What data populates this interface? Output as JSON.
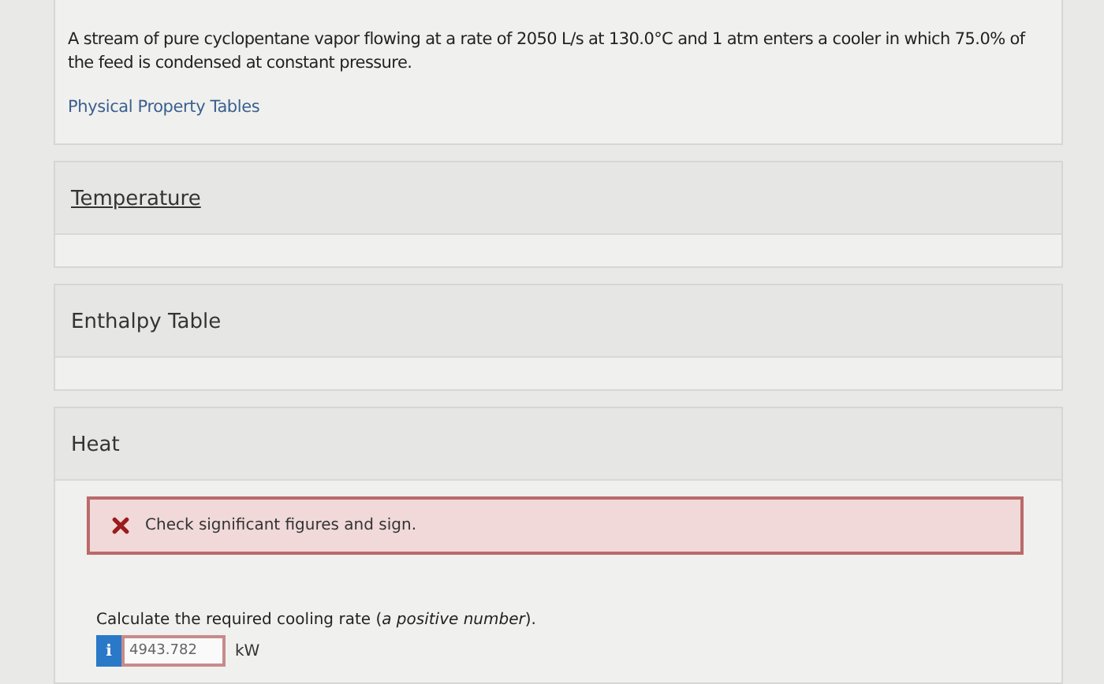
{
  "problem": {
    "text": "A stream of pure cyclopentane vapor flowing at a rate of 2050 L/s at 130.0°C and 1 atm enters a cooler in which 75.0% of the feed is condensed at constant pressure.",
    "link": "Physical Property Tables"
  },
  "sections": [
    {
      "title": "Temperature",
      "underlined": true
    },
    {
      "title": "Enthalpy Table",
      "underlined": false
    }
  ],
  "heat": {
    "title": "Heat",
    "feedback": "Check significant figures and sign.",
    "question": "Calculate the required cooling rate (*a positive number*).",
    "info": "i",
    "answer": "4943.782",
    "unit": "kW"
  }
}
